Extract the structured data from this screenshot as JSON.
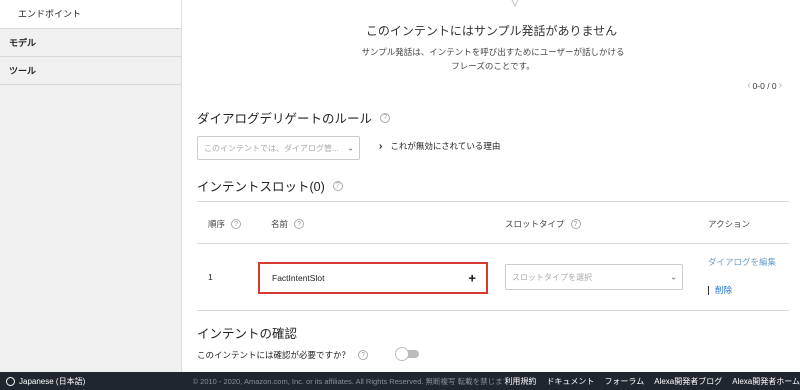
{
  "sidebar": {
    "items": [
      {
        "label": "エンドポイント"
      },
      {
        "label": "モデル"
      },
      {
        "label": "ツール"
      }
    ]
  },
  "utterances": {
    "empty_title": "このインテントにはサンプル発話がありません",
    "empty_desc": "サンプル発話は、インテントを呼び出すためにユーザーが話しかけるフレーズのことです。",
    "pager": "0-0 / 0"
  },
  "dialog_rule": {
    "title": "ダイアログデリゲートのルール",
    "select_placeholder": "このインテントでは、ダイアログ管...",
    "why_label": "これが無効にされている理由"
  },
  "slots": {
    "title": "インテントスロット(0)",
    "columns": {
      "order": "順序",
      "name": "名前",
      "slot_type": "スロットタイプ",
      "action": "アクション"
    },
    "row": {
      "order": "1",
      "name": "FactIntentSlot",
      "slot_type_placeholder": "スロットタイプを選択",
      "edit_dialog": "ダイアログを編集",
      "delete": "削除"
    }
  },
  "confirmation": {
    "title": "インテントの確認",
    "question": "このインテントには確認が必要ですか？",
    "toggle_on": false
  },
  "footer": {
    "language": "Japanese (日本語)",
    "copyright": "© 2010 - 2020, Amazon.com, Inc. or its affiliates. All Rights Reserved. 無断複写 転載を禁じます",
    "links": [
      "利用規約",
      "ドキュメント",
      "フォーラム",
      "Alexa開発者ブログ",
      "Alexa開発者ホーム"
    ]
  }
}
